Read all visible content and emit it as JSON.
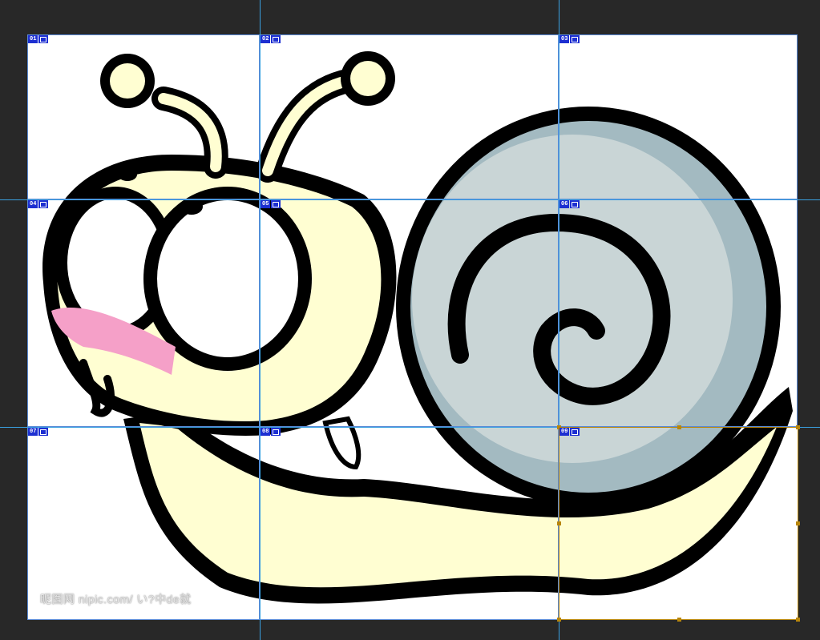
{
  "canvas": {
    "background": "#282828",
    "artboard_background": "#ffffff",
    "guide_color": "#3aa0e0",
    "selection_color": "#b8860b"
  },
  "artwork": {
    "subject": "cartoon snail",
    "colors": {
      "outline": "#000000",
      "body": "#fffed2",
      "shell_light": "#c9d5d6",
      "shell_dark": "#a3bac1",
      "eye_white": "#ffffff",
      "mouth": "#f5a0c8"
    }
  },
  "slices": [
    {
      "id": "01"
    },
    {
      "id": "02"
    },
    {
      "id": "03"
    },
    {
      "id": "04"
    },
    {
      "id": "05"
    },
    {
      "id": "06"
    },
    {
      "id": "07"
    },
    {
      "id": "08"
    },
    {
      "id": "09",
      "selected": true
    }
  ],
  "watermark": {
    "text": "昵图网 nipic.com/ い?中de就"
  }
}
